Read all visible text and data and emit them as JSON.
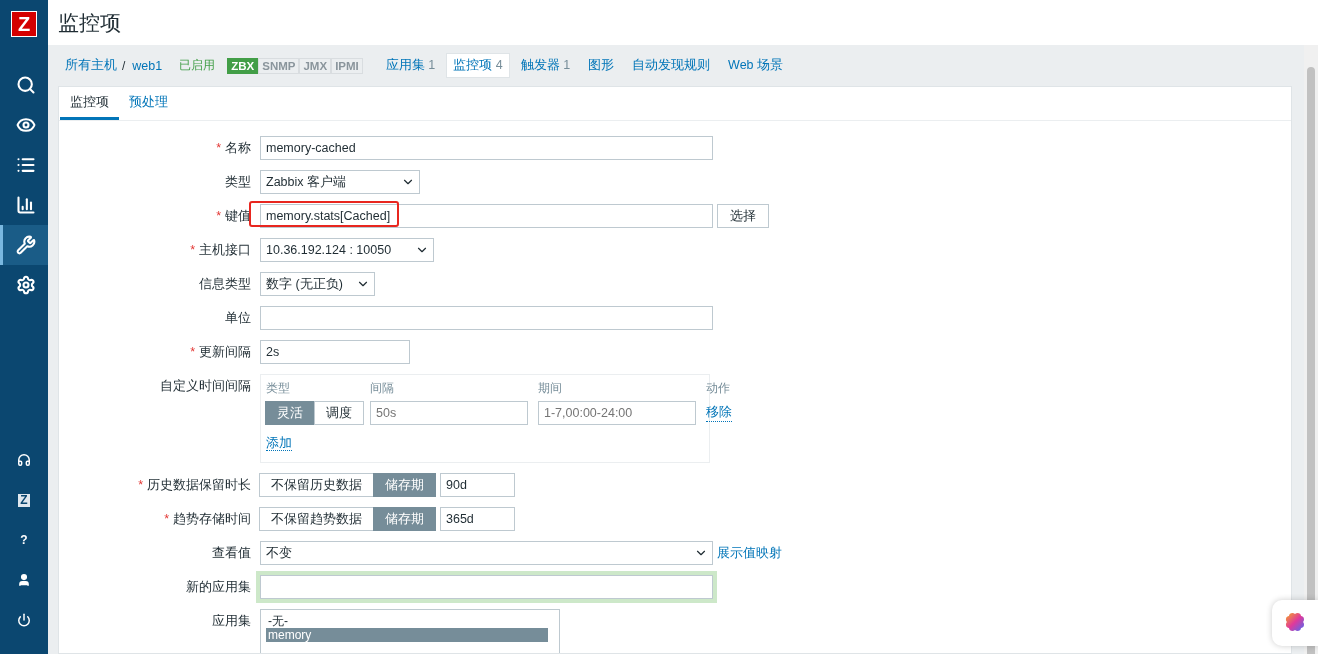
{
  "logo": "Z",
  "sidebar": {
    "top": [
      {
        "kind": "search",
        "selected": false
      },
      {
        "kind": "eye",
        "selected": false
      },
      {
        "kind": "list",
        "selected": false
      },
      {
        "kind": "chart",
        "selected": false
      },
      {
        "kind": "wrench",
        "selected": true
      },
      {
        "kind": "gear",
        "selected": false
      }
    ],
    "bottom": [
      {
        "kind": "headset"
      },
      {
        "kind": "letter",
        "label": "Z"
      },
      {
        "kind": "letter",
        "label": "?"
      },
      {
        "kind": "user"
      },
      {
        "kind": "power"
      }
    ]
  },
  "header": {
    "title": "监控项"
  },
  "nav": [
    {
      "kind": "link",
      "label": "所有主机"
    },
    {
      "kind": "separator",
      "label": "/"
    },
    {
      "kind": "link",
      "label": "web1"
    },
    {
      "kind": "status",
      "label": "已启用"
    },
    {
      "kind": "availability",
      "badges": [
        {
          "label": "ZBX",
          "on": true
        },
        {
          "label": "SNMP",
          "on": false
        },
        {
          "label": "JMX",
          "on": false
        },
        {
          "label": "IPMI",
          "on": false
        }
      ]
    },
    {
      "kind": "tab",
      "label": "应用集",
      "count": "1",
      "selected": false
    },
    {
      "kind": "tab",
      "label": "监控项",
      "count": "4",
      "selected": true
    },
    {
      "kind": "tab",
      "label": "触发器",
      "count": "1",
      "selected": false
    },
    {
      "kind": "tab",
      "label": "图形",
      "selected": false
    },
    {
      "kind": "tab",
      "label": "自动发现规则",
      "selected": false
    },
    {
      "kind": "tab",
      "label": "Web 场景",
      "selected": false
    }
  ],
  "tabs": [
    {
      "label": "监控项",
      "selected": true
    },
    {
      "label": "预处理",
      "selected": false
    }
  ],
  "form": [
    {
      "kind": "text",
      "label": "名称",
      "mark": "*",
      "value": "memory-cached"
    },
    {
      "kind": "select",
      "label": "类型",
      "value": "Zabbix 客户端"
    },
    {
      "kind": "text_button",
      "label": "键值",
      "mark": "*",
      "value": "memory.stats[Cached]",
      "highlighted": true,
      "button": "选择"
    },
    {
      "kind": "select",
      "label": "主机接口",
      "mark": "*",
      "value": "10.36.192.124 : 10050"
    },
    {
      "kind": "select",
      "label": "信息类型",
      "value": "数字 (无正负)"
    },
    {
      "kind": "text",
      "label": "单位"
    },
    {
      "kind": "text",
      "label": "更新间隔",
      "mark": "*",
      "value": "2s"
    },
    {
      "kind": "intervals",
      "label": "自定义时间间隔",
      "columns": [
        "类型",
        "间隔",
        "期间",
        "动作"
      ],
      "rows": [
        {
          "modes": [
            {
              "label": "灵活",
              "selected": true
            },
            {
              "label": "调度",
              "selected": false
            }
          ],
          "interval_placeholder": "50s",
          "period_placeholder": "1-7,00:00-24:00",
          "action": "移除"
        }
      ],
      "add": "添加"
    },
    {
      "kind": "toggle_text",
      "label": "历史数据保留时长",
      "mark": "*",
      "options": [
        {
          "label": "不保留历史数据",
          "selected": false
        },
        {
          "label": "储存期",
          "selected": true
        }
      ],
      "value": "90d"
    },
    {
      "kind": "toggle_text",
      "label": "趋势存储时间",
      "mark": "*",
      "options": [
        {
          "label": "不保留趋势数据",
          "selected": false
        },
        {
          "label": "储存期",
          "selected": true
        }
      ],
      "value": "365d"
    },
    {
      "kind": "select_link",
      "label": "查看值",
      "value": "不变",
      "link": "展示值映射"
    },
    {
      "kind": "text",
      "label": "新的应用集",
      "focused": true
    },
    {
      "kind": "listbox",
      "label": "应用集",
      "items": [
        {
          "label": "-无-",
          "selected": false
        },
        {
          "label": "memory",
          "selected": true
        }
      ]
    }
  ]
}
